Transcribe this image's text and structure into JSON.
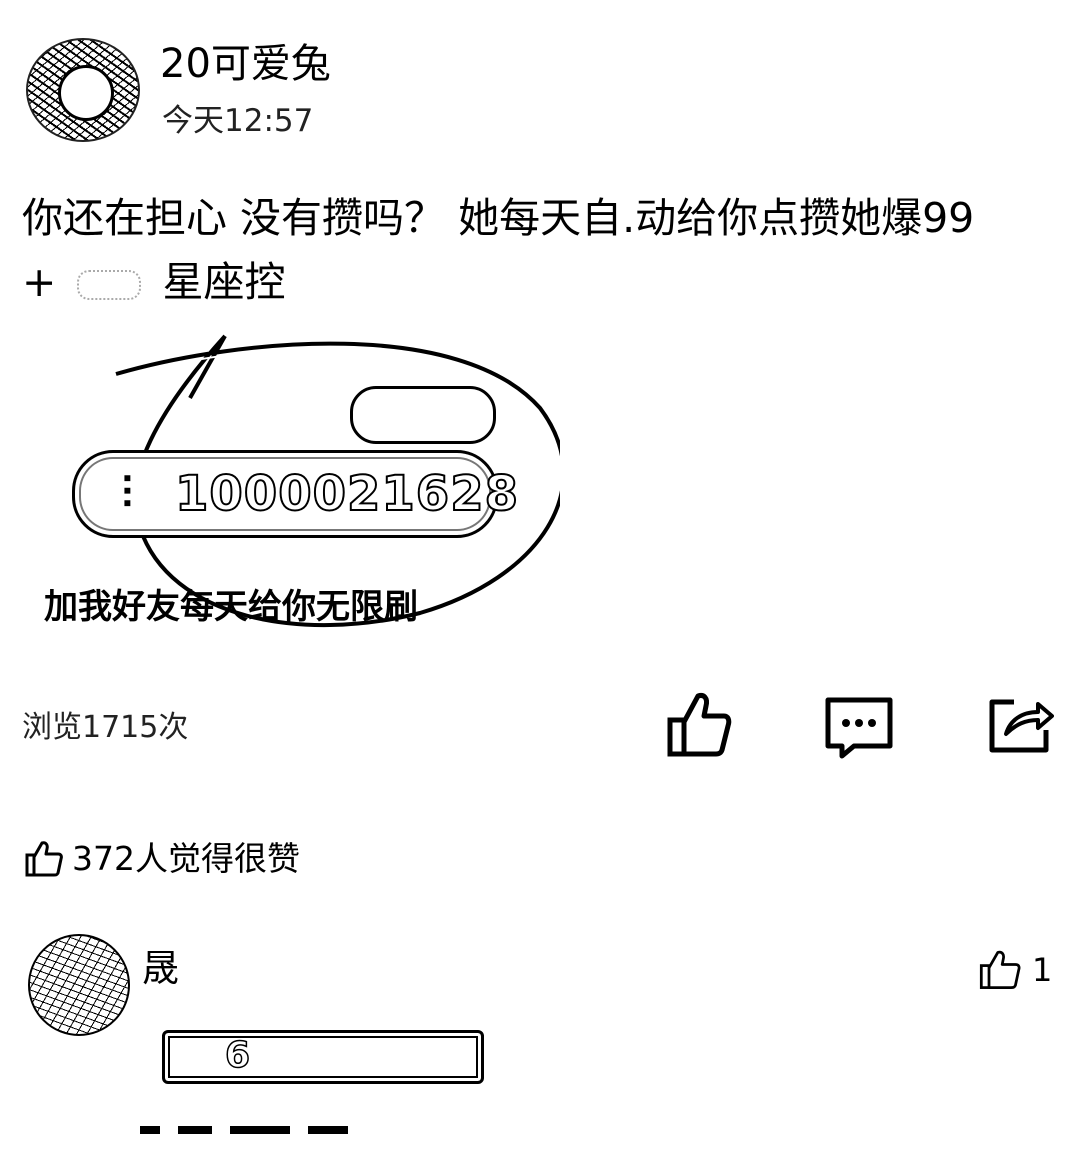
{
  "post": {
    "author": "20可爱兔",
    "time": "今天12:57",
    "text_line1": "你还在担心 没有攒吗？ 她每天自.动给你点攒她爆99",
    "text_line2_prefix": "+",
    "text_line2_suffix": "星座控"
  },
  "embed": {
    "pill_small": "",
    "id_number": "1000021628",
    "caption": "加我好友每天给你无限刷"
  },
  "stats": {
    "views": "浏览1715次",
    "likes_summary": "372人觉得很赞"
  },
  "actions": {
    "like_icon": "thumbs-up-icon",
    "comment_icon": "comment-dots-icon",
    "share_icon": "share-icon"
  },
  "comment": {
    "name": "晟",
    "like_count": "1",
    "content": "6"
  }
}
